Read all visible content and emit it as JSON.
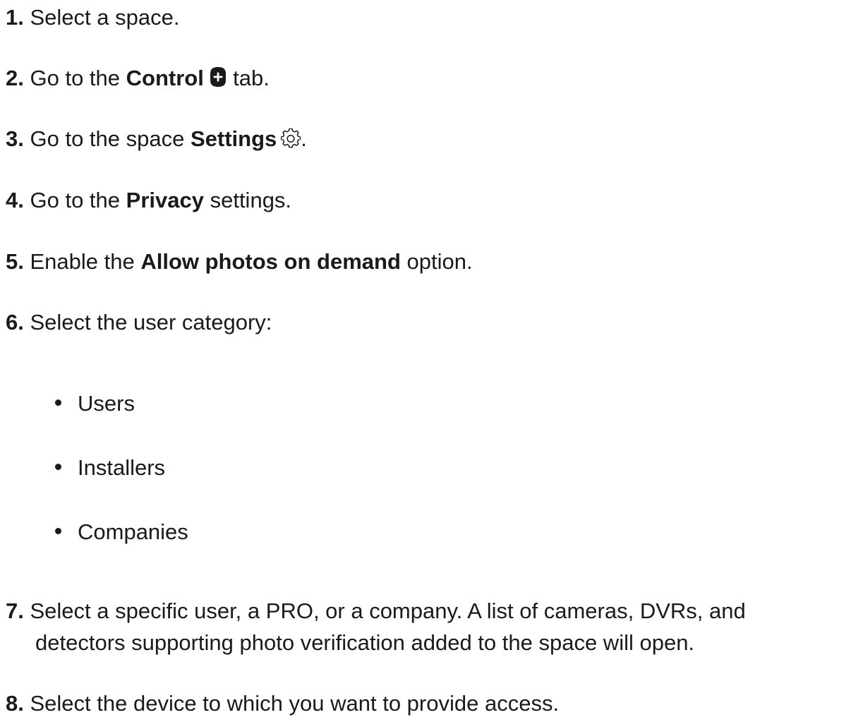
{
  "steps": [
    {
      "num": "1.",
      "text": "Select a space."
    },
    {
      "num": "2.",
      "pre": "Go to the",
      "bold": "Control",
      "icon": "plus-shield-icon",
      "post": "tab."
    },
    {
      "num": "3.",
      "pre": "Go to the space",
      "bold": "Settings",
      "icon": "gear-icon",
      "post": "."
    },
    {
      "num": "4.",
      "pre": "Go to the",
      "bold": "Privacy",
      "post": "settings."
    },
    {
      "num": "5.",
      "pre": "Enable the",
      "bold": "Allow photos on demand",
      "post": "option."
    },
    {
      "num": "6.",
      "text": "Select the user category:"
    },
    {
      "num": "7.",
      "line1": "Select a specific user, a PRO, or a company. A list of cameras, DVRs, and",
      "line2": "detectors supporting photo verification added to the space will open."
    },
    {
      "num": "8.",
      "text": "Select the device to which you want to provide access."
    }
  ],
  "categories": [
    "Users",
    "Installers",
    "Companies"
  ]
}
